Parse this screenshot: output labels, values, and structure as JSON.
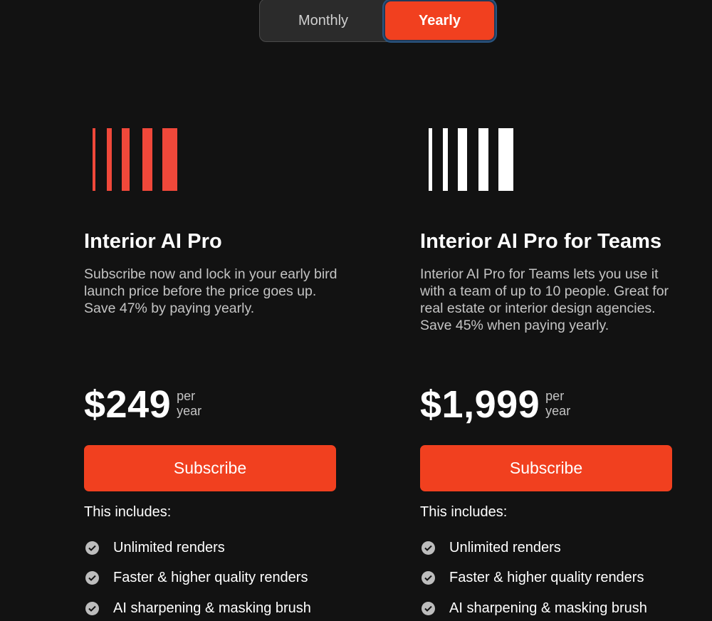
{
  "billing_toggle": {
    "monthly_label": "Monthly",
    "yearly_label": "Yearly",
    "selected": "Yearly"
  },
  "colors": {
    "background": "#121212",
    "accent": "#f1401f",
    "pro_logo": "#f0483a",
    "teams_logo": "#ffffff",
    "muted_text": "#c4c4c4"
  },
  "plans": [
    {
      "logo_icon": "vertical-bars-logo",
      "title": "Interior AI Pro",
      "description": "Subscribe now and lock in your early bird launch price before the price goes up. Save 47% by paying yearly.",
      "price": "$249",
      "price_unit_line1": "per",
      "price_unit_line2": "year",
      "button_label": "Subscribe",
      "includes_label": "This includes:",
      "features": [
        "Unlimited renders",
        "Faster & higher quality renders",
        "AI sharpening & masking brush"
      ]
    },
    {
      "logo_icon": "vertical-bars-logo",
      "title": "Interior AI Pro for Teams",
      "description": "Interior AI Pro for Teams lets you use it with a team of up to 10 people. Great for real estate or interior design agencies. Save 45% when paying yearly.",
      "price": "$1,999",
      "price_unit_line1": "per",
      "price_unit_line2": "year",
      "button_label": "Subscribe",
      "includes_label": "This includes:",
      "features": [
        "Unlimited renders",
        "Faster & higher quality renders",
        "AI sharpening & masking brush"
      ]
    }
  ]
}
